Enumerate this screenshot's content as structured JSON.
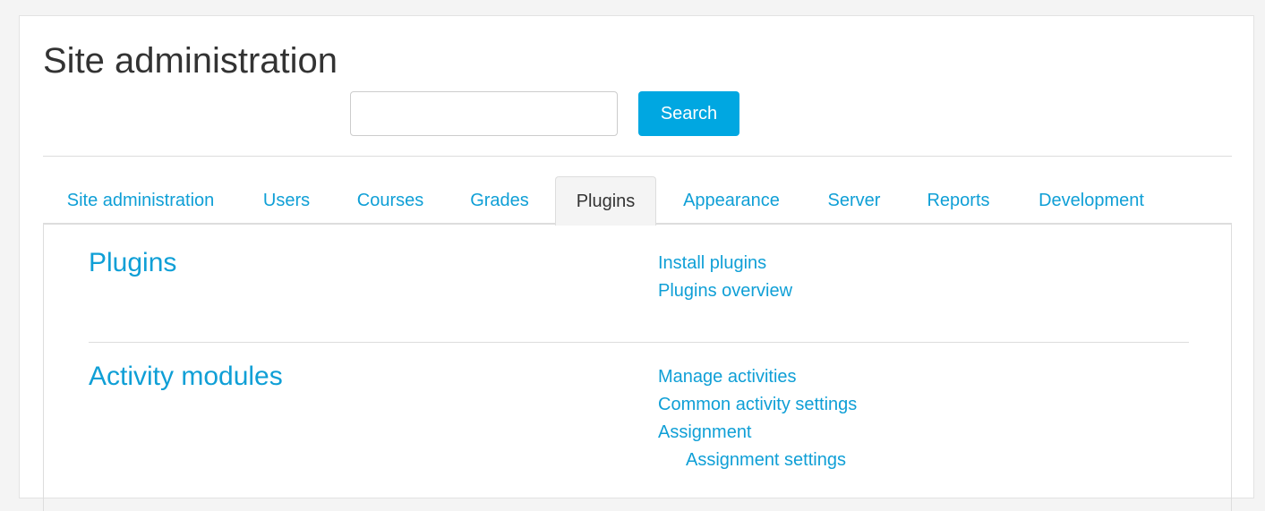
{
  "page": {
    "title": "Site administration"
  },
  "search": {
    "value": "",
    "placeholder": "",
    "button_label": "Search"
  },
  "tabs": [
    {
      "label": "Site administration"
    },
    {
      "label": "Users"
    },
    {
      "label": "Courses"
    },
    {
      "label": "Grades"
    },
    {
      "label": "Plugins",
      "active": true
    },
    {
      "label": "Appearance"
    },
    {
      "label": "Server"
    },
    {
      "label": "Reports"
    },
    {
      "label": "Development"
    }
  ],
  "sections": [
    {
      "heading": "Plugins",
      "links": [
        {
          "label": "Install plugins"
        },
        {
          "label": "Plugins overview"
        }
      ]
    },
    {
      "heading": "Activity modules",
      "links": [
        {
          "label": "Manage activities"
        },
        {
          "label": "Common activity settings"
        },
        {
          "label": "Assignment"
        },
        {
          "label": "Assignment settings",
          "indent": 1
        }
      ]
    }
  ],
  "colors": {
    "link": "#0f9fd6",
    "button": "#00a7e1",
    "page_background": "#f4f4f4",
    "active_tab_background": "#f4f4f4"
  }
}
